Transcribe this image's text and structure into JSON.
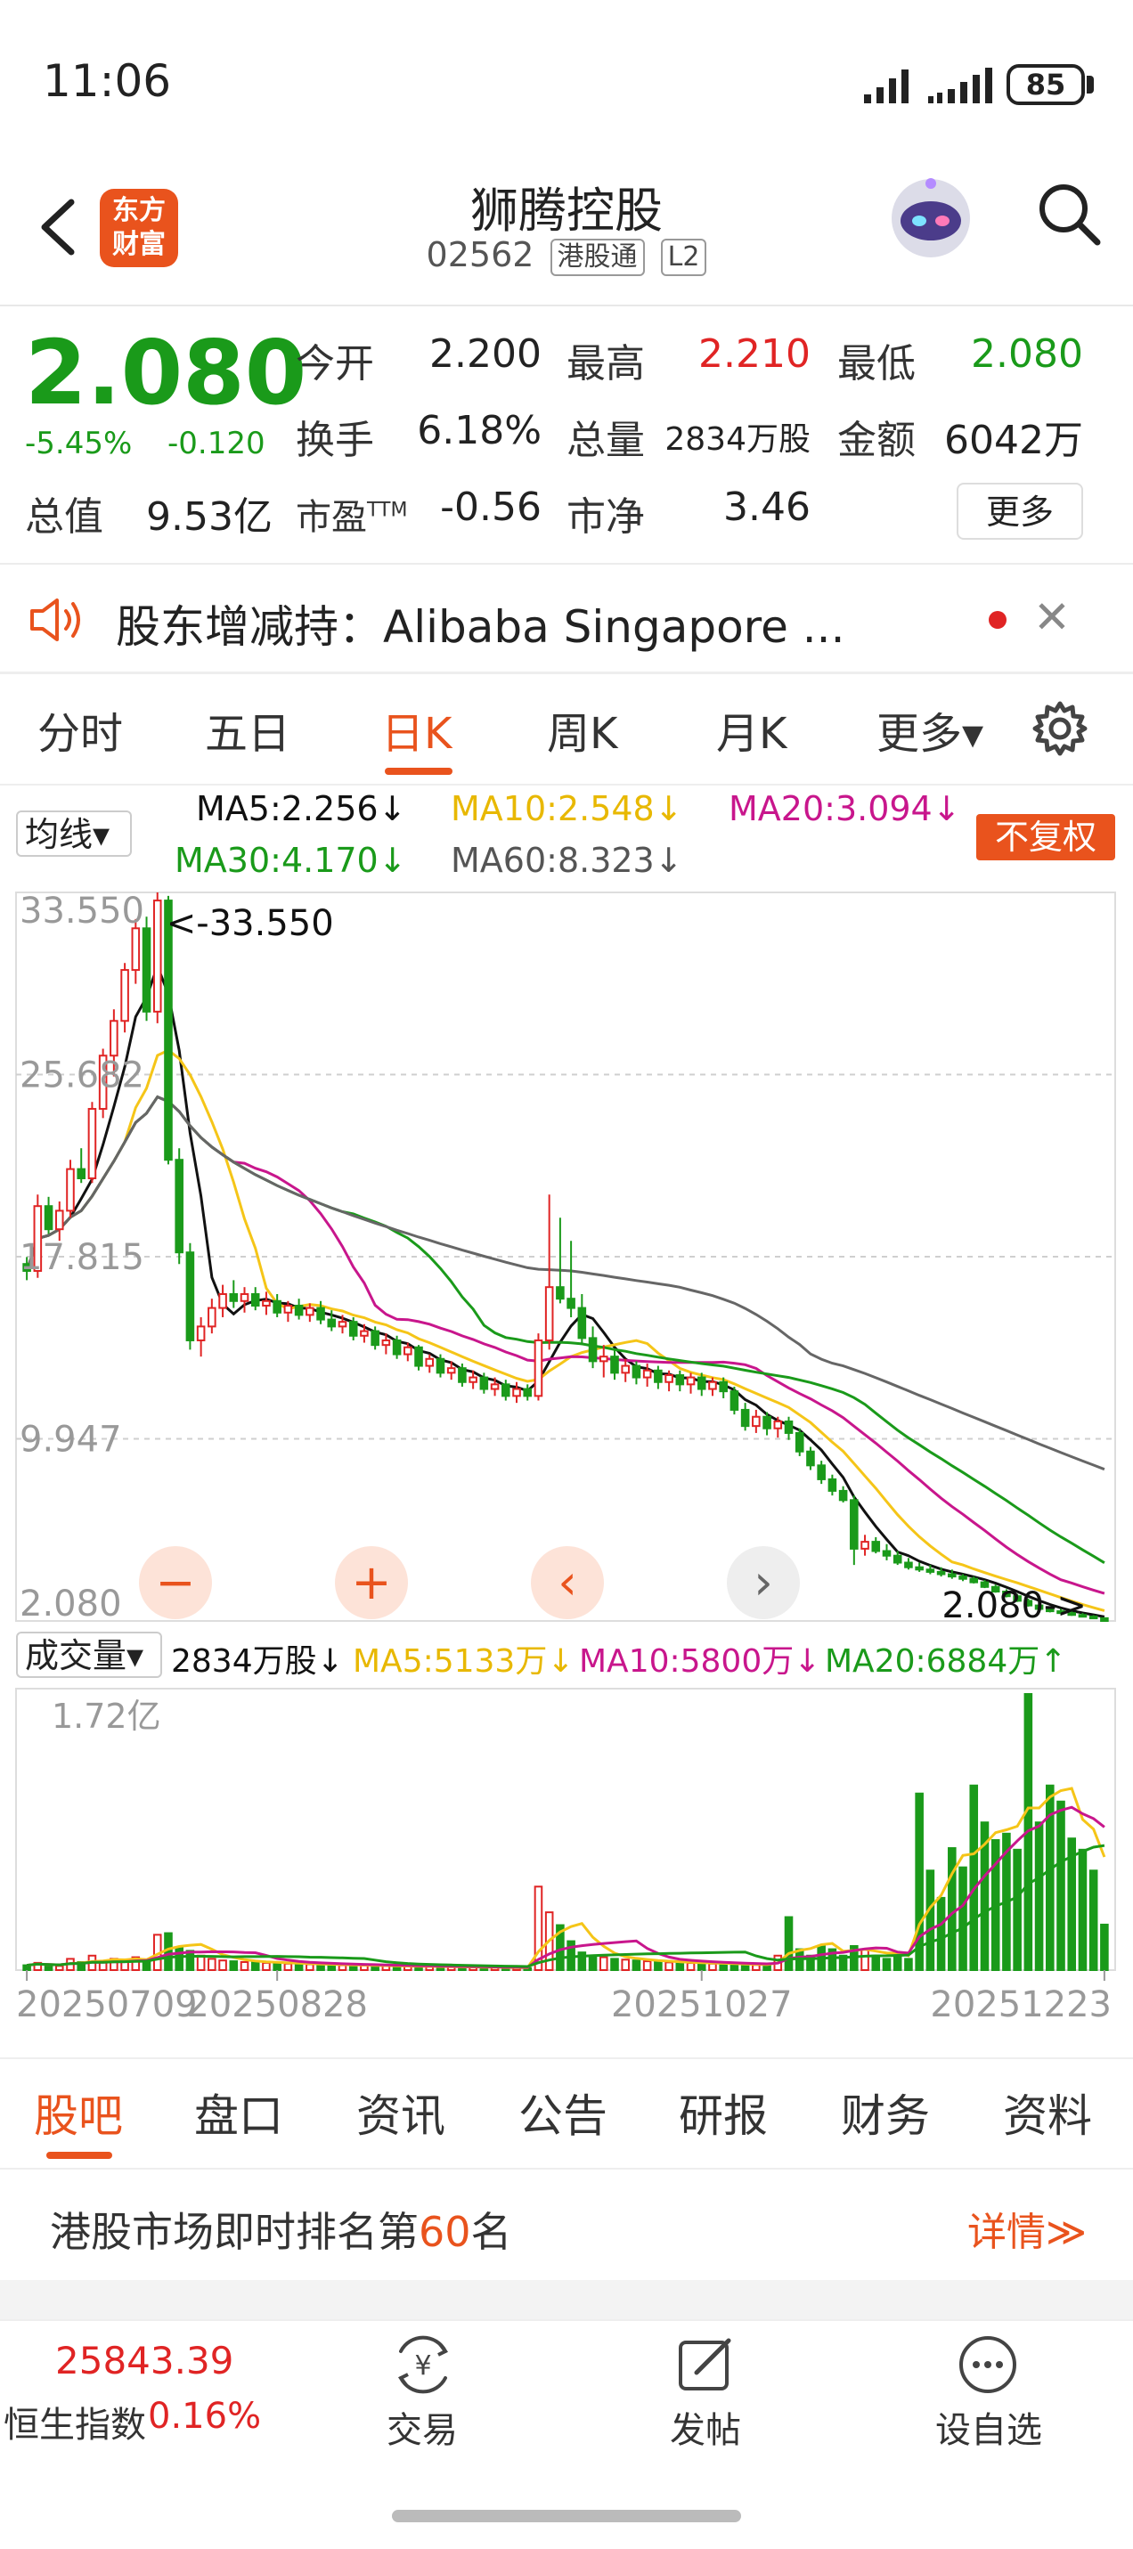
{
  "status": {
    "time": "11:06",
    "battery": "85"
  },
  "header": {
    "logo_line1": "东方",
    "logo_line2": "财富",
    "title": "狮腾控股",
    "code": "02562",
    "tag_connect": "港股通",
    "tag_level": "L2"
  },
  "quote": {
    "price": "2.080",
    "change_pct": "-5.45%",
    "change_abs": "-0.120",
    "open_label": "今开",
    "open": "2.200",
    "high_label": "最高",
    "high": "2.210",
    "low_label": "最低",
    "low": "2.080",
    "turnover_label": "换手",
    "turnover": "6.18%",
    "volume_label": "总量",
    "volume": "2834万股",
    "amount_label": "金额",
    "amount": "6042万",
    "mktcap_label": "总值",
    "mktcap": "9.53亿",
    "pe_label": "市盈",
    "pe_sup": "TTM",
    "pe": "-0.56",
    "pb_label": "市净",
    "pb": "3.46",
    "more": "更多"
  },
  "news": {
    "text": "股东增减持：Alibaba Singapore ..."
  },
  "period_tabs": [
    "分时",
    "五日",
    "日K",
    "周K",
    "月K",
    "更多▾"
  ],
  "ma_legend": {
    "selector": "均线▾",
    "ma5": "MA5:2.256↓",
    "ma10": "MA10:2.548↓",
    "ma20": "MA20:3.094↓",
    "ma30": "MA30:4.170↓",
    "ma60": "MA60:8.323↓",
    "adjust": "不复权"
  },
  "colors": {
    "up": "#e02424",
    "down": "#1a9a1a",
    "ma5": "#111111",
    "ma10": "#f5c518",
    "ma20": "#c8168c",
    "ma30": "#1a9a1a",
    "ma60": "#666666",
    "accent": "#e9531d"
  },
  "chart_data": {
    "type": "candlestick",
    "price_axis_labels": [
      "33.550",
      "25.682",
      "17.815",
      "9.947",
      "2.080"
    ],
    "ylim": [
      2.08,
      33.55
    ],
    "max_marker": "<-33.550",
    "min_marker": "2.080->",
    "x_tick_labels": [
      "20250709",
      "20250828",
      "20251027",
      "20251223"
    ],
    "candles": [
      [
        17.5,
        17.8,
        16.8,
        17.2
      ],
      [
        17.2,
        20.5,
        16.9,
        20.0
      ],
      [
        20.0,
        20.4,
        18.8,
        19.0
      ],
      [
        19.0,
        20.2,
        18.5,
        19.8
      ],
      [
        19.8,
        22.0,
        19.5,
        21.6
      ],
      [
        21.6,
        22.5,
        21.0,
        21.2
      ],
      [
        21.2,
        24.5,
        21.0,
        24.2
      ],
      [
        24.2,
        26.8,
        23.8,
        26.5
      ],
      [
        26.5,
        28.5,
        25.6,
        28.0
      ],
      [
        28.0,
        30.5,
        27.5,
        30.2
      ],
      [
        30.2,
        32.4,
        29.6,
        32.0
      ],
      [
        32.0,
        32.5,
        28.0,
        28.4
      ],
      [
        28.4,
        33.55,
        27.9,
        33.2
      ],
      [
        33.2,
        33.4,
        21.8,
        22.0
      ],
      [
        22.0,
        22.5,
        17.5,
        18.0
      ],
      [
        18.0,
        18.4,
        13.8,
        14.2
      ],
      [
        14.2,
        15.2,
        13.5,
        14.8
      ],
      [
        14.8,
        16.0,
        14.5,
        15.6
      ],
      [
        15.6,
        16.6,
        15.2,
        16.2
      ],
      [
        16.2,
        16.8,
        15.6,
        15.9
      ],
      [
        15.9,
        16.5,
        15.4,
        16.2
      ],
      [
        16.2,
        16.5,
        15.5,
        15.7
      ],
      [
        15.7,
        16.3,
        15.3,
        15.9
      ],
      [
        15.9,
        16.2,
        15.2,
        15.4
      ],
      [
        15.4,
        15.9,
        15.0,
        15.7
      ],
      [
        15.7,
        16.0,
        15.1,
        15.3
      ],
      [
        15.3,
        15.8,
        15.0,
        15.6
      ],
      [
        15.6,
        15.9,
        14.9,
        15.1
      ],
      [
        15.1,
        15.5,
        14.6,
        14.8
      ],
      [
        14.8,
        15.3,
        14.5,
        15.0
      ],
      [
        15.0,
        15.2,
        14.2,
        14.4
      ],
      [
        14.4,
        14.9,
        14.1,
        14.6
      ],
      [
        14.6,
        14.8,
        13.8,
        14.0
      ],
      [
        14.0,
        14.5,
        13.6,
        14.2
      ],
      [
        14.2,
        14.4,
        13.4,
        13.6
      ],
      [
        13.6,
        14.1,
        13.3,
        13.9
      ],
      [
        13.9,
        14.0,
        12.9,
        13.1
      ],
      [
        13.1,
        13.6,
        12.8,
        13.4
      ],
      [
        13.4,
        13.6,
        12.6,
        12.8
      ],
      [
        12.8,
        13.3,
        12.5,
        13.0
      ],
      [
        13.0,
        13.2,
        12.2,
        12.4
      ],
      [
        12.4,
        12.9,
        12.1,
        12.6
      ],
      [
        12.6,
        12.8,
        11.9,
        12.1
      ],
      [
        12.1,
        12.6,
        11.8,
        12.3
      ],
      [
        12.3,
        12.5,
        11.6,
        11.8
      ],
      [
        11.8,
        12.4,
        11.5,
        12.1
      ],
      [
        12.1,
        12.3,
        11.6,
        11.8
      ],
      [
        11.8,
        14.5,
        11.6,
        14.2
      ],
      [
        14.2,
        20.5,
        13.8,
        16.5
      ],
      [
        16.5,
        19.5,
        15.8,
        16.0
      ],
      [
        16.0,
        18.5,
        15.2,
        15.6
      ],
      [
        15.6,
        16.2,
        14.0,
        14.3
      ],
      [
        14.3,
        14.8,
        13.0,
        13.3
      ],
      [
        13.3,
        14.0,
        12.6,
        13.5
      ],
      [
        13.5,
        13.8,
        12.5,
        12.8
      ],
      [
        12.8,
        13.4,
        12.4,
        13.1
      ],
      [
        13.1,
        13.3,
        12.3,
        12.6
      ],
      [
        12.6,
        13.2,
        12.2,
        12.9
      ],
      [
        12.9,
        13.1,
        12.1,
        12.4
      ],
      [
        12.4,
        12.9,
        12.0,
        12.7
      ],
      [
        12.7,
        12.9,
        12.0,
        12.3
      ],
      [
        12.3,
        12.8,
        11.9,
        12.6
      ],
      [
        12.6,
        12.8,
        11.8,
        12.1
      ],
      [
        12.1,
        12.6,
        11.8,
        12.4
      ],
      [
        12.4,
        12.6,
        11.7,
        12.0
      ],
      [
        12.0,
        12.2,
        11.0,
        11.2
      ],
      [
        11.2,
        11.5,
        10.3,
        10.5
      ],
      [
        10.5,
        11.2,
        10.2,
        10.9
      ],
      [
        10.9,
        11.1,
        10.1,
        10.4
      ],
      [
        10.4,
        10.9,
        10.0,
        10.7
      ],
      [
        10.7,
        10.9,
        9.9,
        10.2
      ],
      [
        10.2,
        10.4,
        9.2,
        9.4
      ],
      [
        9.4,
        9.6,
        8.6,
        8.8
      ],
      [
        8.8,
        9.0,
        8.0,
        8.2
      ],
      [
        8.2,
        8.4,
        7.5,
        7.7
      ],
      [
        7.7,
        7.9,
        7.2,
        7.3
      ],
      [
        7.3,
        7.5,
        4.5,
        5.2
      ],
      [
        5.2,
        5.8,
        4.9,
        5.5
      ],
      [
        5.5,
        5.7,
        5.0,
        5.1
      ],
      [
        5.1,
        5.4,
        4.7,
        4.9
      ],
      [
        4.9,
        5.1,
        4.5,
        4.6
      ],
      [
        4.6,
        4.8,
        4.3,
        4.4
      ],
      [
        4.4,
        4.6,
        4.2,
        4.3
      ],
      [
        4.3,
        4.5,
        4.1,
        4.2
      ],
      [
        4.2,
        4.4,
        4.0,
        4.1
      ],
      [
        4.1,
        4.3,
        3.9,
        4.0
      ],
      [
        4.0,
        4.1,
        3.8,
        3.9
      ],
      [
        3.9,
        4.0,
        3.7,
        3.75
      ],
      [
        3.75,
        3.85,
        3.5,
        3.55
      ],
      [
        3.55,
        3.65,
        3.3,
        3.35
      ],
      [
        3.35,
        3.45,
        3.1,
        3.15
      ],
      [
        3.15,
        3.25,
        2.9,
        2.95
      ],
      [
        2.95,
        3.05,
        2.7,
        2.75
      ],
      [
        2.75,
        2.85,
        2.55,
        2.6
      ],
      [
        2.6,
        2.7,
        2.45,
        2.5
      ],
      [
        2.5,
        2.6,
        2.38,
        2.42
      ],
      [
        2.42,
        2.5,
        2.3,
        2.34
      ],
      [
        2.34,
        2.42,
        2.24,
        2.27
      ],
      [
        2.27,
        2.33,
        2.18,
        2.2
      ],
      [
        2.2,
        2.21,
        2.08,
        2.08
      ]
    ]
  },
  "volume_legend": {
    "selector": "成交量▾",
    "vol": "2834万股↓",
    "ma5": "MA5:5133万↓",
    "ma10": "MA10:5800万↓",
    "ma20": "MA20:6884万↑"
  },
  "volume_data": {
    "ylim_label": "1.72亿",
    "ymax": 17200,
    "values": [
      300,
      450,
      300,
      260,
      700,
      500,
      900,
      500,
      700,
      600,
      800,
      650,
      2200,
      2300,
      1400,
      1200,
      900,
      700,
      600,
      550,
      500,
      480,
      450,
      420,
      400,
      380,
      360,
      340,
      320,
      300,
      300,
      280,
      260,
      250,
      240,
      230,
      220,
      210,
      200,
      190,
      180,
      170,
      160,
      150,
      140,
      130,
      130,
      5200,
      3600,
      2800,
      1800,
      1100,
      900,
      800,
      700,
      650,
      600,
      550,
      500,
      480,
      460,
      440,
      420,
      400,
      380,
      360,
      340,
      320,
      300,
      900,
      3300,
      1300,
      900,
      1500,
      1300,
      900,
      1500,
      1300,
      900,
      700,
      900,
      700,
      11000,
      6200,
      4500,
      7600,
      6400,
      11500,
      9200,
      8100,
      8500,
      7500,
      17200,
      9200,
      11500,
      10500,
      8200,
      7500,
      6200,
      2834
    ]
  },
  "section_tabs": [
    "股吧",
    "盘口",
    "资讯",
    "公告",
    "研报",
    "财务",
    "资料"
  ],
  "rank": {
    "prefix": "港股市场即时排名第",
    "number": "60",
    "suffix": "名",
    "detail": "详情≫"
  },
  "bottom_nav": {
    "index_value": "25843.39",
    "index_name": "恒生指数",
    "index_change": "0.16%",
    "trade": "交易",
    "post": "发帖",
    "watch": "设自选"
  }
}
